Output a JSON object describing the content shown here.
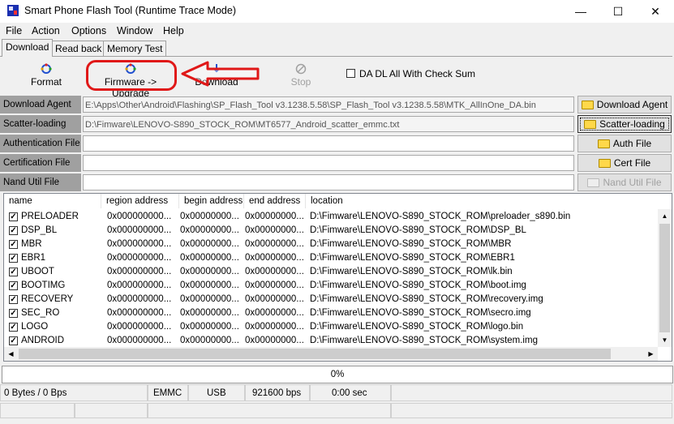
{
  "window": {
    "title": "Smart Phone Flash Tool (Runtime Trace Mode)",
    "controls": {
      "minimize": "—",
      "maximize": "☐",
      "close": "✕"
    }
  },
  "menu": [
    "File",
    "Action",
    "Options",
    "Window",
    "Help"
  ],
  "tabs": [
    {
      "label": "Download",
      "active": true
    },
    {
      "label": "Read back",
      "active": false
    },
    {
      "label": "Memory Test",
      "active": false
    }
  ],
  "toolbar": {
    "format": "Format",
    "firmware_upgrade": "Firmware -> Upgrade",
    "download": "Download",
    "stop": "Stop",
    "da_checksum_label": "DA DL All With Check Sum",
    "da_checksum_checked": false
  },
  "fields": {
    "download_agent": {
      "label": "Download Agent",
      "value": "E:\\Apps\\Other\\Android\\Flashing\\SP_Flash_Tool v3.1238.5.58\\SP_Flash_Tool v3.1238.5.58\\MTK_AllInOne_DA.bin"
    },
    "scatter": {
      "label": "Scatter-loading File",
      "value": "D:\\Fimware\\LENOVO-S890_STOCK_ROM\\MT6577_Android_scatter_emmc.txt"
    },
    "auth": {
      "label": "Authentication File",
      "value": ""
    },
    "cert": {
      "label": "Certification File",
      "value": ""
    },
    "nand": {
      "label": "Nand Util File",
      "value": ""
    }
  },
  "side_buttons": {
    "download_agent": "Download Agent",
    "scatter": "Scatter-loading",
    "auth": "Auth File",
    "cert": "Cert File",
    "nand": "Nand Util File"
  },
  "table": {
    "columns": [
      "name",
      "region address",
      "begin address",
      "end address",
      "location"
    ],
    "rows": [
      {
        "checked": true,
        "name": "PRELOADER",
        "region": "0x000000000...",
        "begin": "0x00000000...",
        "end": "0x00000000...",
        "location": "D:\\Fimware\\LENOVO-S890_STOCK_ROM\\preloader_s890.bin"
      },
      {
        "checked": true,
        "name": "DSP_BL",
        "region": "0x000000000...",
        "begin": "0x00000000...",
        "end": "0x00000000...",
        "location": "D:\\Fimware\\LENOVO-S890_STOCK_ROM\\DSP_BL"
      },
      {
        "checked": true,
        "name": "MBR",
        "region": "0x000000000...",
        "begin": "0x00000000...",
        "end": "0x00000000...",
        "location": "D:\\Fimware\\LENOVO-S890_STOCK_ROM\\MBR"
      },
      {
        "checked": true,
        "name": "EBR1",
        "region": "0x000000000...",
        "begin": "0x00000000...",
        "end": "0x00000000...",
        "location": "D:\\Fimware\\LENOVO-S890_STOCK_ROM\\EBR1"
      },
      {
        "checked": true,
        "name": "UBOOT",
        "region": "0x000000000...",
        "begin": "0x00000000...",
        "end": "0x00000000...",
        "location": "D:\\Fimware\\LENOVO-S890_STOCK_ROM\\lk.bin"
      },
      {
        "checked": true,
        "name": "BOOTIMG",
        "region": "0x000000000...",
        "begin": "0x00000000...",
        "end": "0x00000000...",
        "location": "D:\\Fimware\\LENOVO-S890_STOCK_ROM\\boot.img"
      },
      {
        "checked": true,
        "name": "RECOVERY",
        "region": "0x000000000...",
        "begin": "0x00000000...",
        "end": "0x00000000...",
        "location": "D:\\Fimware\\LENOVO-S890_STOCK_ROM\\recovery.img"
      },
      {
        "checked": true,
        "name": "SEC_RO",
        "region": "0x000000000...",
        "begin": "0x00000000...",
        "end": "0x00000000...",
        "location": "D:\\Fimware\\LENOVO-S890_STOCK_ROM\\secro.img"
      },
      {
        "checked": true,
        "name": "LOGO",
        "region": "0x000000000...",
        "begin": "0x00000000...",
        "end": "0x00000000...",
        "location": "D:\\Fimware\\LENOVO-S890_STOCK_ROM\\logo.bin"
      },
      {
        "checked": true,
        "name": "ANDROID",
        "region": "0x000000000...",
        "begin": "0x00000000...",
        "end": "0x00000000...",
        "location": "D:\\Fimware\\LENOVO-S890_STOCK_ROM\\system.img"
      }
    ]
  },
  "progress": {
    "text": "0%",
    "value": 0
  },
  "status": {
    "transfer": "0 Bytes / 0 Bps",
    "storage": "EMMC",
    "port": "USB",
    "baud": "921600 bps",
    "time": "0:00 sec"
  },
  "colors": {
    "annotation": "#e01818",
    "label_bg": "#a0a0a0"
  }
}
